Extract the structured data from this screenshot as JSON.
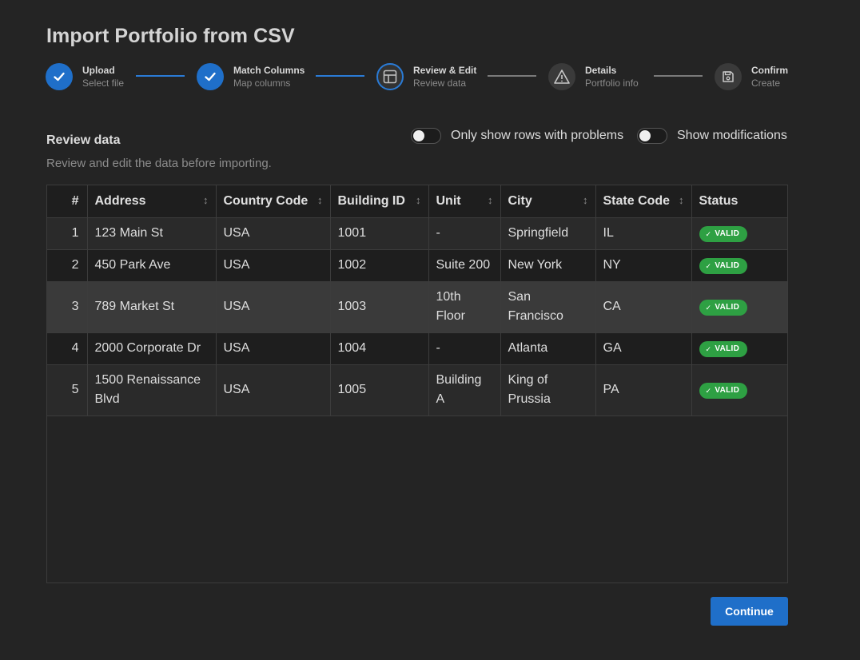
{
  "page": {
    "title": "Import Portfolio from CSV"
  },
  "stepper": {
    "steps": [
      {
        "title": "Upload",
        "subtitle": "Select file",
        "state": "done",
        "icon": "check-icon"
      },
      {
        "title": "Match Columns",
        "subtitle": "Map columns",
        "state": "done",
        "icon": "check-icon"
      },
      {
        "title": "Review & Edit",
        "subtitle": "Review data",
        "state": "current",
        "icon": "table-icon"
      },
      {
        "title": "Details",
        "subtitle": "Portfolio info",
        "state": "todo",
        "icon": "warning-icon"
      },
      {
        "title": "Confirm",
        "subtitle": "Create",
        "state": "todo",
        "icon": "save-icon"
      }
    ]
  },
  "review": {
    "title": "Review data",
    "description": "Review and edit the data before importing.",
    "toggle_problems_label": "Only show rows with problems",
    "toggle_problems_on": false,
    "toggle_mods_label": "Show modifications",
    "toggle_mods_on": false
  },
  "table": {
    "headers": [
      "#",
      "Address",
      "Country Code",
      "Building ID",
      "Unit",
      "City",
      "State Code",
      "Status"
    ],
    "rows": [
      {
        "n": "1",
        "address": "123 Main St",
        "country": "USA",
        "building": "1001",
        "unit": "-",
        "city": "Springfield",
        "state": "IL",
        "status": "VALID"
      },
      {
        "n": "2",
        "address": "450 Park Ave",
        "country": "USA",
        "building": "1002",
        "unit": "Suite 200",
        "city": "New York",
        "state": "NY",
        "status": "VALID"
      },
      {
        "n": "3",
        "address": "789 Market St",
        "country": "USA",
        "building": "1003",
        "unit": "10th Floor",
        "city": "San Francisco",
        "state": "CA",
        "status": "VALID"
      },
      {
        "n": "4",
        "address": "2000 Corporate Dr",
        "country": "USA",
        "building": "1004",
        "unit": "-",
        "city": "Atlanta",
        "state": "GA",
        "status": "VALID"
      },
      {
        "n": "5",
        "address": "1500 Renaissance Blvd",
        "country": "USA",
        "building": "1005",
        "unit": "Building A",
        "city": "King of Prussia",
        "state": "PA",
        "status": "VALID"
      }
    ]
  },
  "footer": {
    "continue_label": "Continue"
  },
  "colors": {
    "accent": "#1f6fc9",
    "valid": "#2ea043",
    "background": "#242424"
  }
}
